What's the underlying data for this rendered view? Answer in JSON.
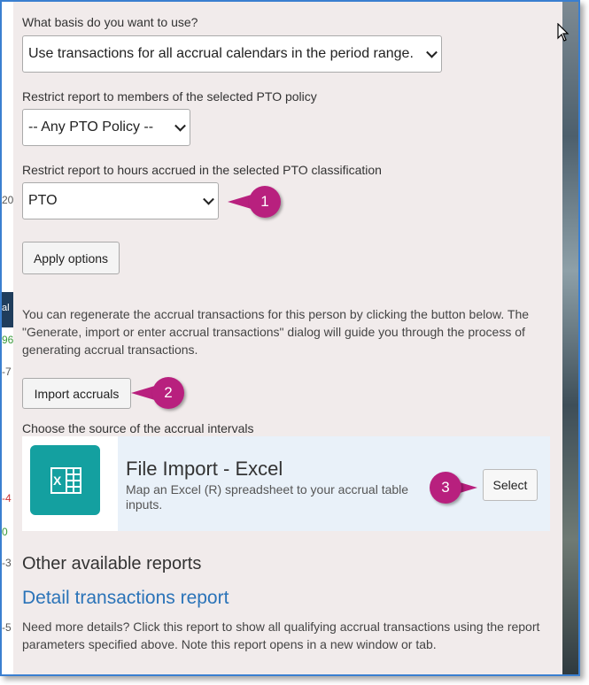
{
  "form": {
    "basis_label": "What basis do you want to use?",
    "basis_value": "Use transactions for all accrual calendars in the period range.",
    "policy_label": "Restrict report to members of the selected PTO policy",
    "policy_value": "-- Any PTO Policy --",
    "classification_label": "Restrict report to hours accrued in the selected PTO classification",
    "classification_value": "PTO",
    "apply_button": "Apply options"
  },
  "regen": {
    "text": "You can regenerate the accrual transactions for this person by clicking the button below. The \"Generate, import or enter accrual transactions\" dialog will guide you through the process of generating accrual transactions.",
    "import_button": "Import accruals"
  },
  "source": {
    "label": "Choose the source of the accrual intervals",
    "card_title": "File Import - Excel",
    "card_desc": "Map an Excel (R) spreadsheet to your accrual table inputs.",
    "select_button": "Select",
    "icon": "excel-icon"
  },
  "other": {
    "heading": "Other available reports",
    "link": "Detail transactions report",
    "desc": "Need more details? Click this report to show all qualifying accrual transactions using the report parameters specified above. Note this report opens in a new window or tab."
  },
  "callouts": [
    "1",
    "2",
    "3"
  ],
  "background_fragments": [
    "20",
    "al",
    "96",
    "-7",
    "-4",
    "0",
    "-3",
    "-5"
  ],
  "colors": {
    "panel": "#f1ebeb",
    "callout": "#b8207e",
    "link": "#2a73b8",
    "excel": "#14a0a0",
    "frame": "#3a7fd0"
  }
}
